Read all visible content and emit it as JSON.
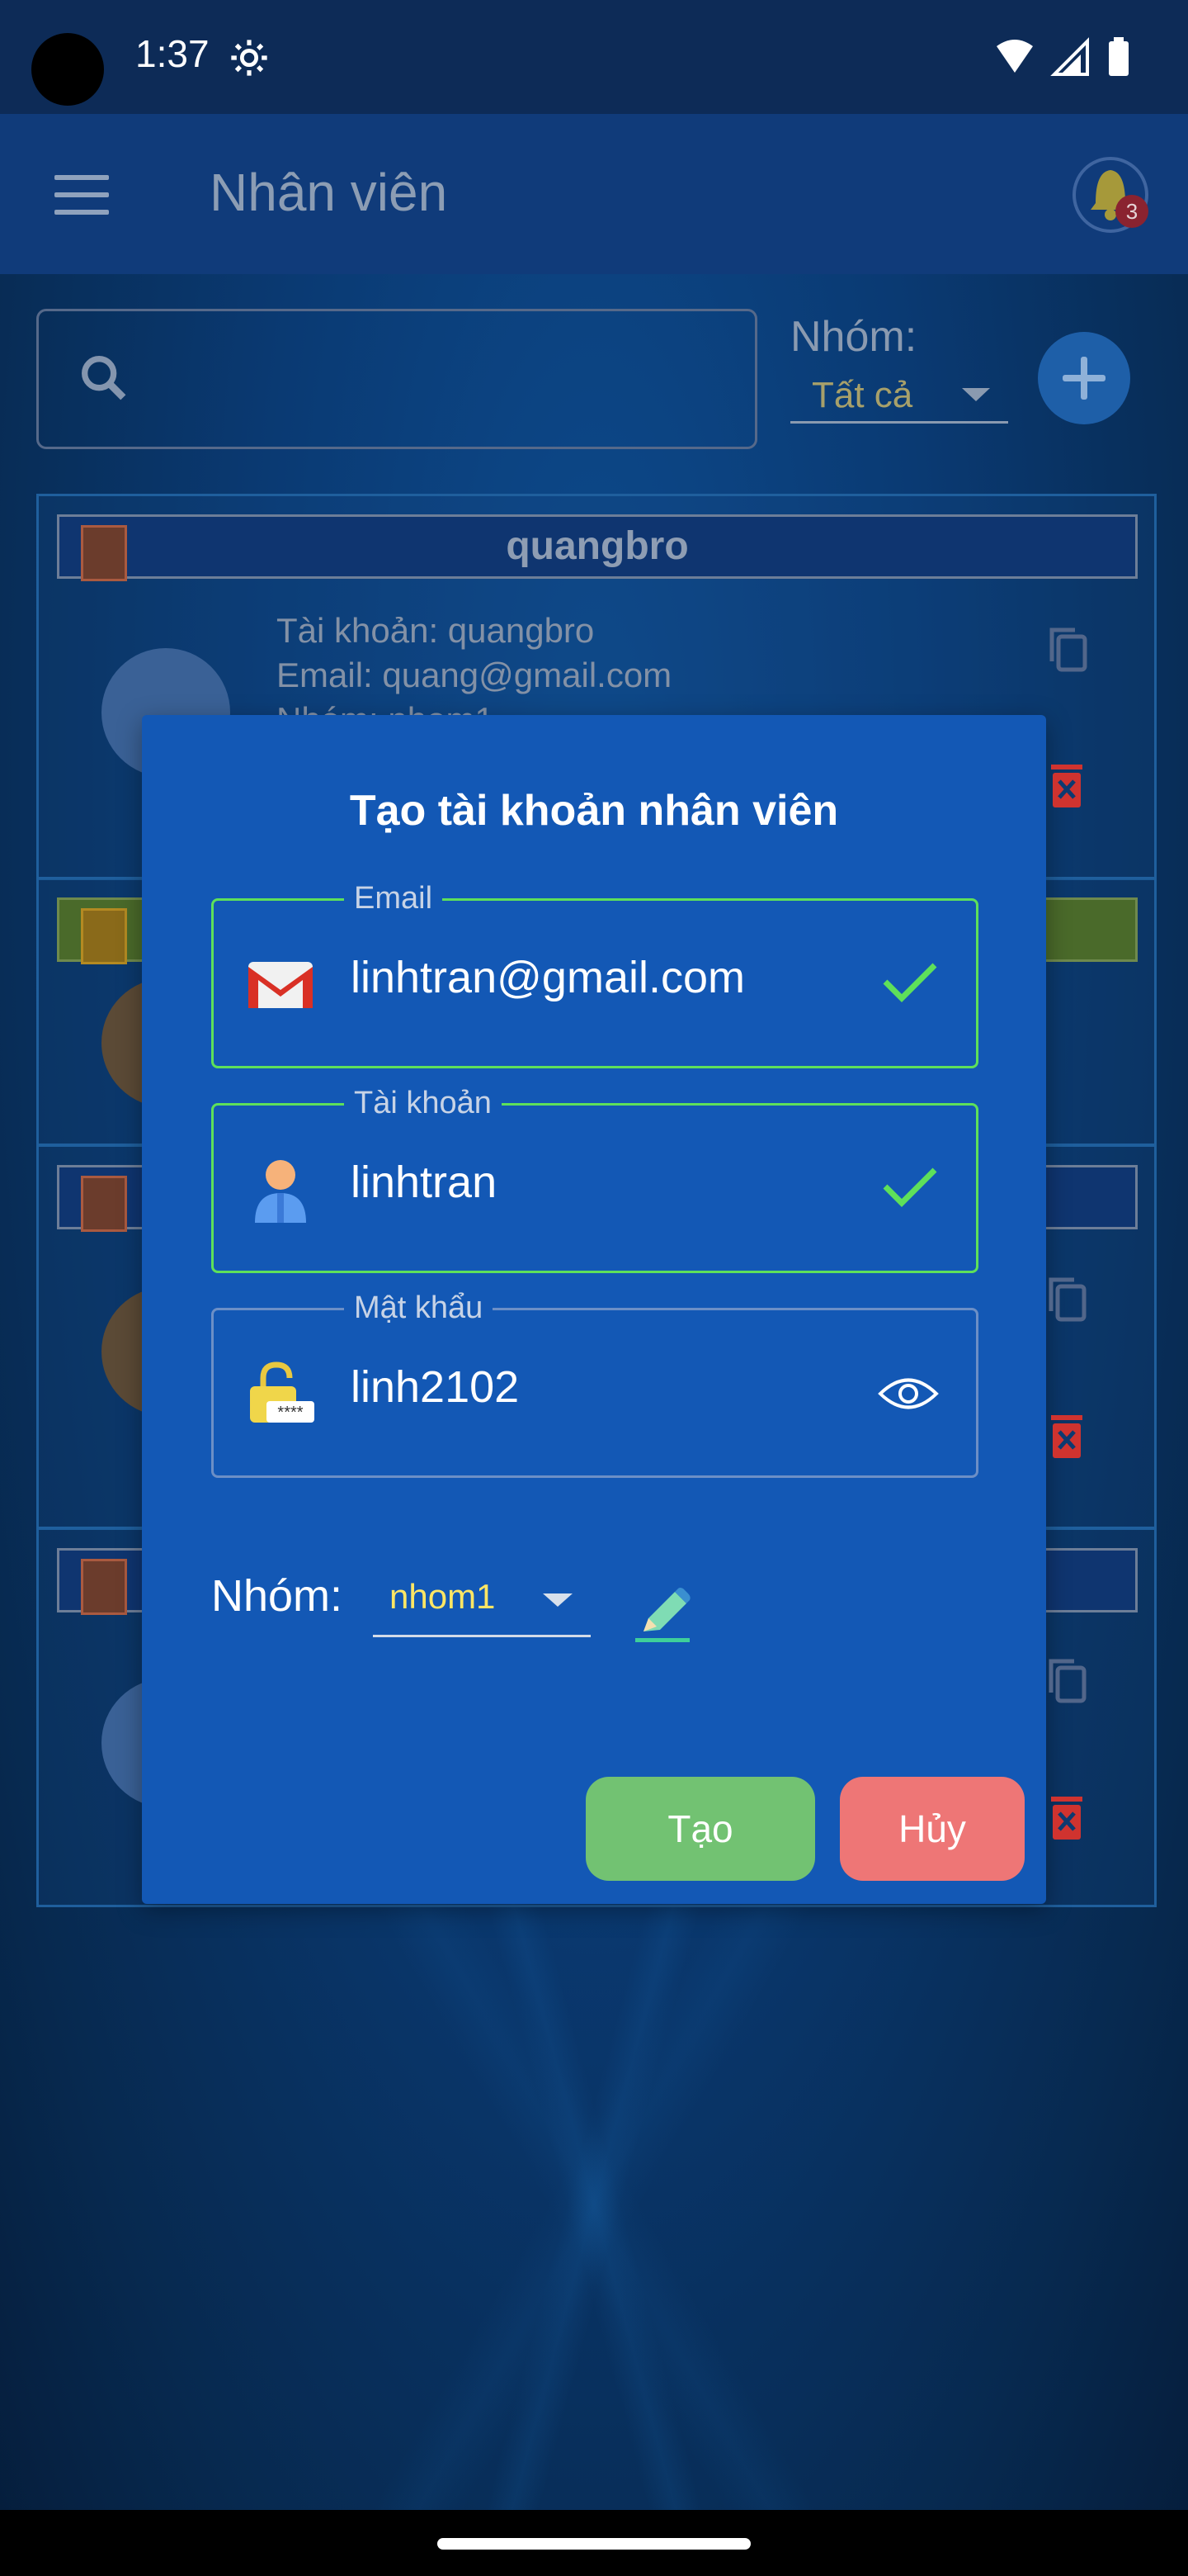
{
  "status_bar": {
    "time": "1:37"
  },
  "app_bar": {
    "title": "Nhân viên",
    "notification_count": "3"
  },
  "filter": {
    "search_placeholder": "",
    "group_label": "Nhóm:",
    "group_value": "Tất cả"
  },
  "cards": [
    {
      "name": "quangbro",
      "account_line": "Tài khoản: quangbro",
      "email_line": "Email: quang@gmail.com",
      "group_line": "Nhóm: nhom1"
    }
  ],
  "dialog": {
    "title": "Tạo tài khoản nhân viên",
    "email": {
      "label": "Email",
      "value": "linhtran@gmail.com"
    },
    "account": {
      "label": "Tài khoản",
      "value": "linhtran"
    },
    "password": {
      "label": "Mật khẩu",
      "value": "linh2102"
    },
    "group_label": "Nhóm:",
    "group_value": "nhom1",
    "create_label": "Tạo",
    "cancel_label": "Hủy"
  },
  "colors": {
    "dialog_bg": "#1358b5",
    "valid_border": "#5ee05a",
    "create_button": "#72c272",
    "cancel_button": "#ee7676",
    "group_value_text": "#ffe664"
  },
  "icons": [
    "menu-icon",
    "bell-icon",
    "search-icon",
    "add-icon",
    "copy-icon",
    "trash-icon",
    "gmail-icon",
    "user-icon",
    "lock-icon",
    "check-icon",
    "eye-icon",
    "edit-icon"
  ]
}
